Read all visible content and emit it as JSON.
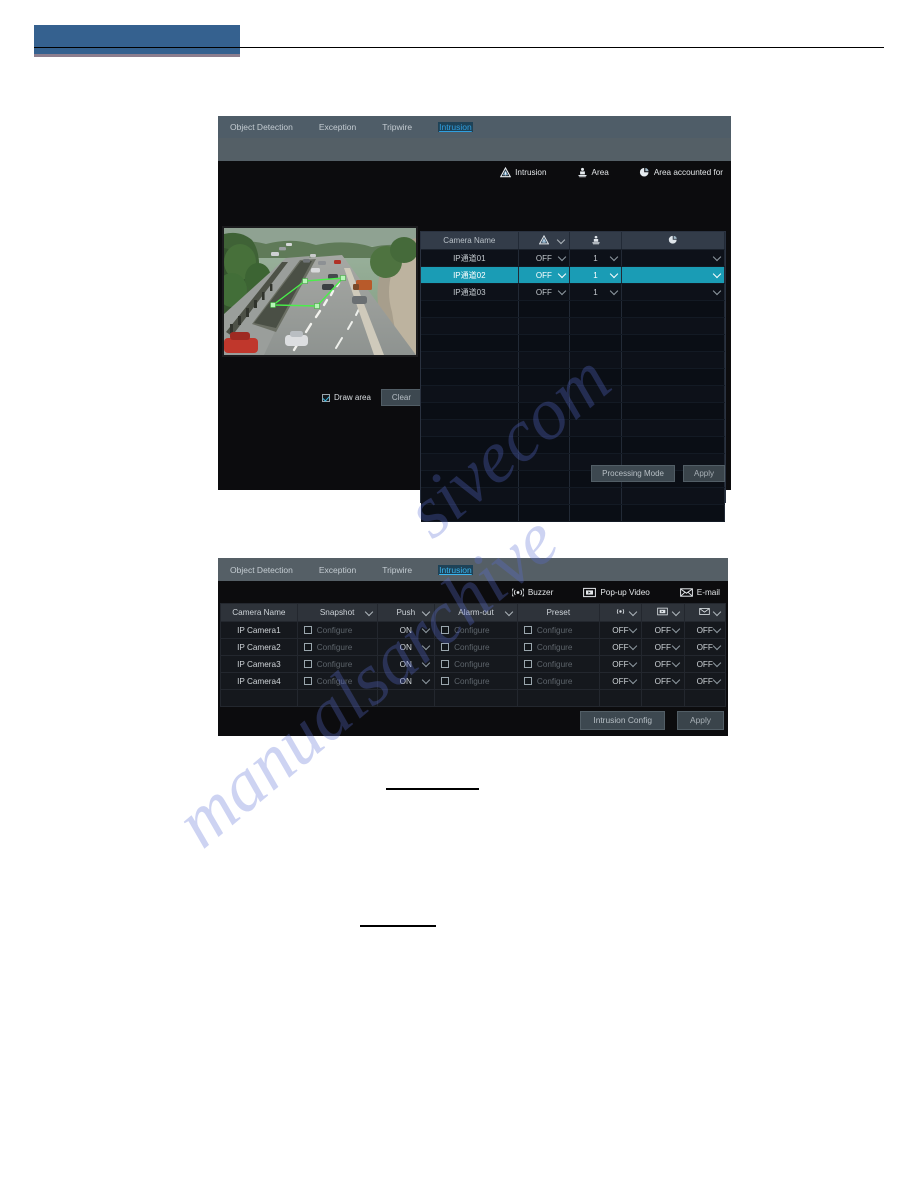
{
  "document": {
    "header_band_color": "#35618f",
    "watermark_lines": [
      "sivecom",
      "manualsarchive"
    ]
  },
  "panel_intrusion_settings": {
    "tabs": [
      {
        "label": "Object Detection",
        "active": false
      },
      {
        "label": "Exception",
        "active": false
      },
      {
        "label": "Tripwire",
        "active": false
      },
      {
        "label": "Intrusion",
        "active": true
      }
    ],
    "legend": [
      {
        "icon": "warning-triangle-icon",
        "label": "Intrusion"
      },
      {
        "icon": "intruder-icon",
        "label": "Area"
      },
      {
        "icon": "pie-chart-icon",
        "label": "Area accounted for"
      }
    ],
    "preview": {
      "scene": "highway-traffic",
      "polygon_color": "#4cf04c"
    },
    "draw_area": {
      "label": "Draw area",
      "checked": true
    },
    "clear_button": "Clear",
    "table": {
      "headers": [
        {
          "label": "Camera Name",
          "icon": "",
          "dropdown": false
        },
        {
          "label": "",
          "icon": "warning-triangle-icon",
          "dropdown": true
        },
        {
          "label": "",
          "icon": "intruder-icon",
          "dropdown": false
        },
        {
          "label": "",
          "icon": "pie-chart-icon",
          "dropdown": false
        }
      ],
      "rows": [
        {
          "camera": "IP通道01",
          "intrusion": "OFF",
          "area": "1",
          "accounted": "",
          "selected": false
        },
        {
          "camera": "IP通道02",
          "intrusion": "OFF",
          "area": "1",
          "accounted": "",
          "selected": true
        },
        {
          "camera": "IP通道03",
          "intrusion": "OFF",
          "area": "1",
          "accounted": "",
          "selected": false
        }
      ],
      "empty_row_count": 13
    },
    "buttons": {
      "processing_mode": "Processing Mode",
      "apply": "Apply"
    },
    "selected_row_color": "#1a9cb5"
  },
  "panel_intrusion_alarm": {
    "tabs": [
      {
        "label": "Object Detection",
        "active": false
      },
      {
        "label": "Exception",
        "active": false
      },
      {
        "label": "Tripwire",
        "active": false
      },
      {
        "label": "Intrusion",
        "active": true
      }
    ],
    "legend": [
      {
        "icon": "buzzer-icon",
        "label": "Buzzer"
      },
      {
        "icon": "popup-video-icon",
        "label": "Pop-up Video"
      },
      {
        "icon": "email-icon",
        "label": "E-mail"
      }
    ],
    "table": {
      "headers": [
        {
          "label": "Camera Name",
          "icon": "",
          "dropdown": false
        },
        {
          "label": "Snapshot",
          "icon": "",
          "dropdown": true
        },
        {
          "label": "Push",
          "icon": "",
          "dropdown": true
        },
        {
          "label": "Alarm-out",
          "icon": "",
          "dropdown": true
        },
        {
          "label": "Preset",
          "icon": "",
          "dropdown": false
        },
        {
          "label": "",
          "icon": "buzzer-icon",
          "dropdown": true
        },
        {
          "label": "",
          "icon": "popup-video-icon",
          "dropdown": true
        },
        {
          "label": "",
          "icon": "email-icon",
          "dropdown": true
        }
      ],
      "configure_label": "Configure",
      "rows": [
        {
          "camera": "IP Camera1",
          "snapshot": "Configure",
          "snapshot_checked": false,
          "push": "ON",
          "alarm_out": "Configure",
          "alarm_out_checked": false,
          "preset": "Configure",
          "preset_checked": false,
          "buzzer": "OFF",
          "popup": "OFF",
          "email": "OFF"
        },
        {
          "camera": "IP Camera2",
          "snapshot": "Configure",
          "snapshot_checked": false,
          "push": "ON",
          "alarm_out": "Configure",
          "alarm_out_checked": false,
          "preset": "Configure",
          "preset_checked": false,
          "buzzer": "OFF",
          "popup": "OFF",
          "email": "OFF"
        },
        {
          "camera": "IP Camera3",
          "snapshot": "Configure",
          "snapshot_checked": false,
          "push": "ON",
          "alarm_out": "Configure",
          "alarm_out_checked": false,
          "preset": "Configure",
          "preset_checked": false,
          "buzzer": "OFF",
          "popup": "OFF",
          "email": "OFF"
        },
        {
          "camera": "IP Camera4",
          "snapshot": "Configure",
          "snapshot_checked": false,
          "push": "ON",
          "alarm_out": "Configure",
          "alarm_out_checked": false,
          "preset": "Configure",
          "preset_checked": false,
          "buzzer": "OFF",
          "popup": "OFF",
          "email": "OFF"
        }
      ]
    },
    "buttons": {
      "intrusion_config": "Intrusion Config",
      "apply": "Apply"
    }
  }
}
